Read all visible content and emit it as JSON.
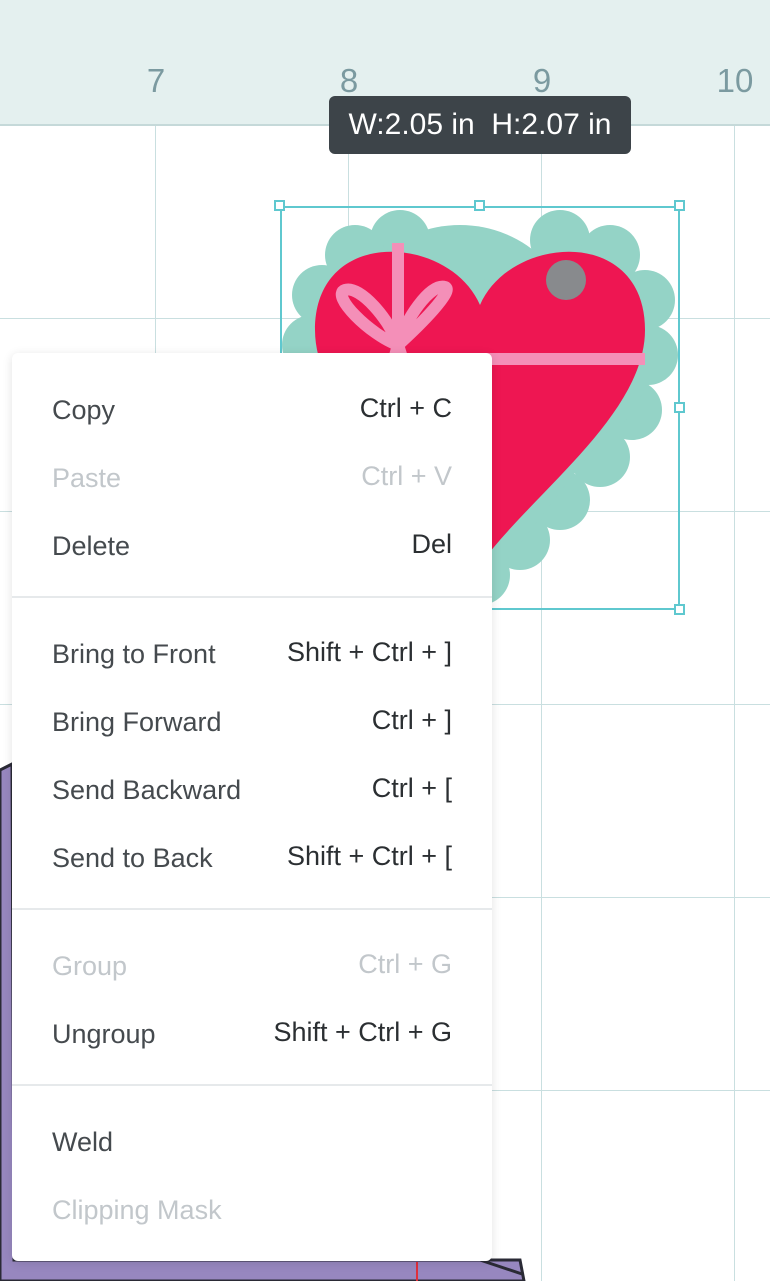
{
  "ruler": {
    "ticks": [
      "7",
      "8",
      "9",
      "10"
    ]
  },
  "tooltip": {
    "text": "W:2.05 in  H:2.07 in"
  },
  "colors": {
    "heart_red": "#ee1652",
    "heart_pink": "#f48fb8",
    "scallop": "#94d3c6",
    "dot": "#888a8d",
    "selection": "#5fc8cf",
    "purple_shape": "#9787bf"
  },
  "menu": {
    "items": [
      {
        "label": "Copy",
        "shortcut": "Ctrl + C",
        "enabled": true
      },
      {
        "label": "Paste",
        "shortcut": "Ctrl + V",
        "enabled": false
      },
      {
        "label": "Delete",
        "shortcut": "Del",
        "enabled": true
      },
      {
        "label": "Bring to Front",
        "shortcut": "Shift + Ctrl + ]",
        "enabled": true
      },
      {
        "label": "Bring Forward",
        "shortcut": "Ctrl + ]",
        "enabled": true
      },
      {
        "label": "Send Backward",
        "shortcut": "Ctrl + [",
        "enabled": true
      },
      {
        "label": "Send to Back",
        "shortcut": "Shift + Ctrl + [",
        "enabled": true
      },
      {
        "label": "Group",
        "shortcut": "Ctrl + G",
        "enabled": false
      },
      {
        "label": "Ungroup",
        "shortcut": "Shift + Ctrl + G",
        "enabled": true
      },
      {
        "label": "Weld",
        "shortcut": "",
        "enabled": true
      },
      {
        "label": "Clipping Mask",
        "shortcut": "",
        "enabled": false
      }
    ]
  }
}
